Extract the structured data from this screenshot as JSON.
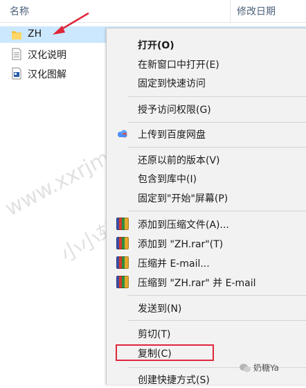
{
  "header": {
    "col_name": "名称",
    "col_date": "修改日期"
  },
  "files": [
    {
      "label": "ZH",
      "icon": "folder-icon",
      "selected": true
    },
    {
      "label": "汉化说明",
      "icon": "text-document-icon"
    },
    {
      "label": "汉化图解",
      "icon": "image-document-icon"
    }
  ],
  "menu": {
    "items": [
      {
        "label": "打开(O)"
      },
      {
        "label": "在新窗口中打开(E)"
      },
      {
        "label": "固定到快速访问"
      },
      {
        "label": "授予访问权限(G)"
      },
      {
        "label": "上传到百度网盘"
      },
      {
        "label": "还原以前的版本(V)"
      },
      {
        "label": "包含到库中(I)"
      },
      {
        "label": "固定到\"开始\"屏幕(P)"
      },
      {
        "label": "添加到压缩文件(A)..."
      },
      {
        "label": "添加到 \"ZH.rar\"(T)"
      },
      {
        "label": "压缩并 E-mail..."
      },
      {
        "label": "压缩到 \"ZH.rar\" 并 E-mail"
      },
      {
        "label": "发送到(N)"
      },
      {
        "label": "剪切(T)"
      },
      {
        "label": "复制(C)"
      },
      {
        "label": "创建快捷方式(S)"
      }
    ]
  },
  "watermark": {
    "text1": "www.xxrjm.com",
    "text2": "小小软件迷"
  },
  "badge": {
    "text": "奶糖Ya"
  },
  "colors": {
    "selection": "#cce8ff",
    "menu_bg": "#f2f2f2",
    "annotation_red": "#e0263a"
  }
}
